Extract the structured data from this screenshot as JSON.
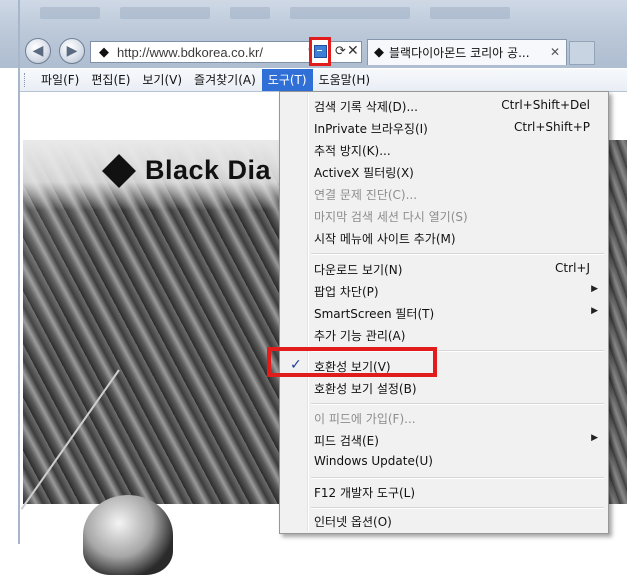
{
  "browser": {
    "address_url": "http://www.bdkorea.co.kr/",
    "tab_title": "블랙다이아몬드 코리아 공...",
    "page_logo_text": "Black Dia"
  },
  "menubar": {
    "items": [
      {
        "label": "파일(F)"
      },
      {
        "label": "편집(E)"
      },
      {
        "label": "보기(V)"
      },
      {
        "label": "즐겨찾기(A)"
      },
      {
        "label": "도구(T)",
        "active": true
      },
      {
        "label": "도움말(H)"
      }
    ]
  },
  "tools_menu": {
    "items": [
      {
        "label": "검색 기록 삭제(D)...",
        "shortcut": "Ctrl+Shift+Del"
      },
      {
        "label": "InPrivate 브라우징(I)",
        "shortcut": "Ctrl+Shift+P"
      },
      {
        "label": "추적 방지(K)..."
      },
      {
        "label": "ActiveX 필터링(X)"
      },
      {
        "label": "연결 문제 진단(C)...",
        "disabled": true
      },
      {
        "label": "마지막 검색 세션 다시 열기(S)",
        "disabled": true
      },
      {
        "label": "시작 메뉴에 사이트 추가(M)"
      },
      {
        "label": "다운로드 보기(N)",
        "shortcut": "Ctrl+J"
      },
      {
        "label": "팝업 차단(P)",
        "submenu": true
      },
      {
        "label": "SmartScreen 필터(T)",
        "submenu": true
      },
      {
        "label": "추가 기능 관리(A)"
      },
      {
        "label": "호환성 보기(V)",
        "checked": true,
        "check_mark": "✓"
      },
      {
        "label": "호환성 보기 설정(B)"
      },
      {
        "label": "이 피드에 가입(F)...",
        "disabled": true
      },
      {
        "label": "피드 검색(E)",
        "submenu": true
      },
      {
        "label": "Windows Update(U)"
      },
      {
        "label": "F12 개발자 도구(L)"
      },
      {
        "label": "인터넷 옵션(O)"
      }
    ]
  },
  "colors": {
    "highlight_border": "#e21b1b",
    "menu_active_bg": "#2f6fd6"
  }
}
